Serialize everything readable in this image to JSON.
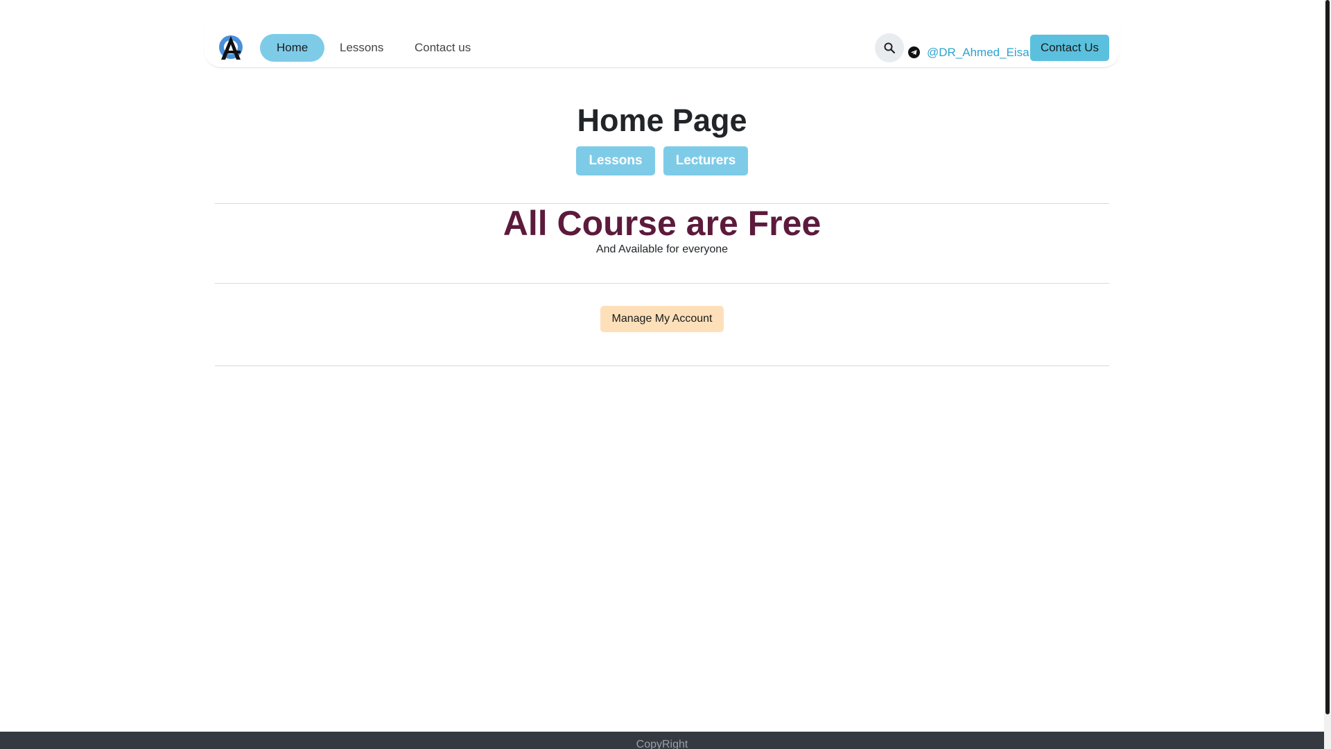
{
  "nav": {
    "items": [
      {
        "label": "Home",
        "active": true
      },
      {
        "label": "Lessons",
        "active": false
      },
      {
        "label": "Contact us",
        "active": false
      }
    ],
    "search_icon": "search-icon",
    "telegram_icon": "telegram-icon",
    "telegram_handle": "@DR_Ahmed_Eisa",
    "contact_button": "Contact Us"
  },
  "hero": {
    "title": "Home Page",
    "buttons": [
      "Lessons",
      "Lecturers"
    ]
  },
  "promo": {
    "title": "All Course are Free",
    "subtitle": "And Available for everyone"
  },
  "account": {
    "manage_button": "Manage My Account"
  },
  "footer": {
    "text": "CopyRight"
  },
  "colors": {
    "accent": "#7ecbe8",
    "contact": "#5bc0de",
    "promo_title": "#5c1a3c",
    "manage_button": "#fde0ba",
    "footer": "#343a40",
    "link": "#2ba3cf"
  }
}
